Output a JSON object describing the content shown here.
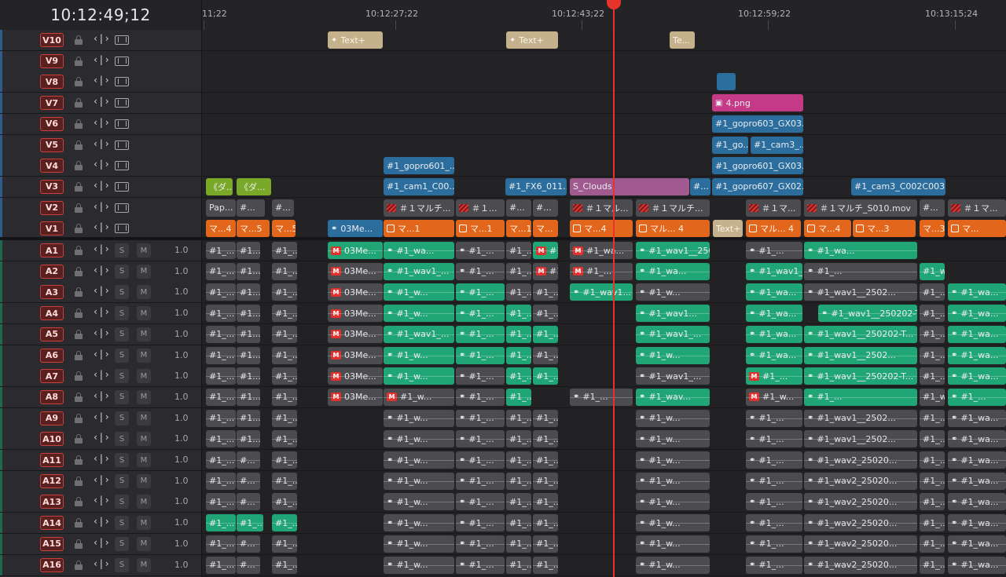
{
  "timecode": "10:12:49;12",
  "ruler": {
    "labels": [
      "11;22",
      "10:12:27;22",
      "10:12:43;22",
      "10:12:59;22",
      "10:13:15;24"
    ]
  },
  "video_tracks": [
    "V10",
    "V9",
    "V8",
    "V7",
    "V6",
    "V5",
    "V4",
    "V3",
    "V2",
    "V1"
  ],
  "audio_tracks": [
    {
      "name": "A1",
      "vol": "1.0",
      "s": "S",
      "m": "M"
    },
    {
      "name": "A2",
      "vol": "1.0",
      "s": "S",
      "m": "M"
    },
    {
      "name": "A3",
      "vol": "1.0",
      "s": "S",
      "m": "M"
    },
    {
      "name": "A4",
      "vol": "1.0",
      "s": "S",
      "m": "M"
    },
    {
      "name": "A5",
      "vol": "1.0",
      "s": "S",
      "m": "M"
    },
    {
      "name": "A6",
      "vol": "1.0",
      "s": "S",
      "m": "M"
    },
    {
      "name": "A7",
      "vol": "1.0",
      "s": "S",
      "m": "M"
    },
    {
      "name": "A8",
      "vol": "1.0",
      "s": "S",
      "m": "M"
    },
    {
      "name": "A9",
      "vol": "1.0",
      "s": "S",
      "m": "M"
    },
    {
      "name": "A10",
      "vol": "1.0",
      "s": "S",
      "m": "M"
    },
    {
      "name": "A11",
      "vol": "1.0",
      "s": "S",
      "m": "M"
    },
    {
      "name": "A12",
      "vol": "1.0",
      "s": "S",
      "m": "M"
    },
    {
      "name": "A13",
      "vol": "1.0",
      "s": "S",
      "m": "M"
    },
    {
      "name": "A14",
      "vol": "1.0",
      "s": "S",
      "m": "M"
    },
    {
      "name": "A15",
      "vol": "1.0",
      "s": "S",
      "m": "M"
    },
    {
      "name": "A16",
      "vol": "1.0",
      "s": "S",
      "m": "M"
    }
  ],
  "autoselect_glyph": "‹|›",
  "clips": {
    "v10": [
      {
        "label": "Text+",
        "color": "tan",
        "icon": "spark"
      },
      {
        "label": "Text+",
        "color": "tan",
        "icon": "spark"
      },
      {
        "label": "Te...",
        "color": "tan"
      }
    ],
    "v8": [
      {
        "label": "",
        "color": "blue"
      }
    ],
    "v7": [
      {
        "label": "4.png",
        "color": "pink",
        "icon": "image"
      }
    ],
    "v6": [
      {
        "label": "#1_gopro603_GX03...",
        "color": "blue"
      }
    ],
    "v5": [
      {
        "label": "#1_go...",
        "color": "blue"
      },
      {
        "label": "#1_cam3_...",
        "color": "blue"
      }
    ],
    "v4": [
      {
        "label": "#1_gopro601_...",
        "color": "blue"
      },
      {
        "label": "#1_gopro601_GX03...",
        "color": "blue"
      }
    ],
    "v3": [
      {
        "label": "《ダ...",
        "color": "lime"
      },
      {
        "label": "《ダ...",
        "color": "lime"
      },
      {
        "label": "#1_cam1_C00...",
        "color": "blue"
      },
      {
        "label": "#1_FX6_011...",
        "color": "blue"
      },
      {
        "label": "S_Clouds",
        "color": "violet"
      },
      {
        "label": "#...",
        "color": "blue"
      },
      {
        "label": "#1_gopro607_GX02...",
        "color": "blue"
      },
      {
        "label": "#1_cam3_C002C003...",
        "color": "blue"
      }
    ],
    "v2": [
      {
        "label": "Pap...",
        "color": "gray"
      },
      {
        "label": "#...",
        "color": "gray"
      },
      {
        "label": "#...",
        "color": "gray"
      },
      {
        "label": "＃１マルチ...",
        "color": "gray",
        "icon": "red"
      },
      {
        "label": "＃１...",
        "color": "gray",
        "icon": "red"
      },
      {
        "label": "#...",
        "color": "gray"
      },
      {
        "label": "#...",
        "color": "gray"
      },
      {
        "label": "＃１マル...",
        "color": "gray",
        "icon": "red"
      },
      {
        "label": "＃１マルチ...",
        "color": "gray",
        "icon": "red"
      },
      {
        "label": "＃１マ...",
        "color": "gray",
        "icon": "red"
      },
      {
        "label": "＃１マルチ_S010.mov",
        "color": "gray",
        "icon": "red"
      },
      {
        "label": "#...",
        "color": "gray"
      },
      {
        "label": "＃１マ...",
        "color": "gray",
        "icon": "red"
      }
    ],
    "v1": [
      {
        "label": "マ...4",
        "color": "orange"
      },
      {
        "label": "マ...5",
        "color": "orange"
      },
      {
        "label": "マ...5",
        "color": "orange"
      },
      {
        "label": "03Me...",
        "color": "blue",
        "icon": "link"
      },
      {
        "label": "マ...1",
        "color": "orange",
        "icon": "grid"
      },
      {
        "label": "マ...1",
        "color": "orange",
        "icon": "grid"
      },
      {
        "label": "マ...1",
        "color": "orange"
      },
      {
        "label": "マ...",
        "color": "orange"
      },
      {
        "label": "マ...4",
        "color": "orange",
        "icon": "grid"
      },
      {
        "label": "マル... 4",
        "color": "orange",
        "icon": "grid"
      },
      {
        "label": "Text+",
        "color": "tan"
      },
      {
        "label": "マル... 4",
        "color": "orange",
        "icon": "grid"
      },
      {
        "label": "マ...4",
        "color": "orange",
        "icon": "grid"
      },
      {
        "label": "マ...3",
        "color": "orange",
        "icon": "grid"
      },
      {
        "label": "マ...3",
        "color": "orange"
      },
      {
        "label": "マ...",
        "color": "orange",
        "icon": "grid"
      }
    ],
    "a1": [
      "#1_...",
      "#1...",
      "#1_...",
      "03Me...",
      "#1_wa...",
      "#1_...",
      "#1_...",
      "#1_...",
      "#1_wa...",
      "#1_wav1__2502...",
      "#1_...",
      "#1_wa..."
    ],
    "a2": [
      "#1_...",
      "#1...",
      "#1_...",
      "03Me...",
      "#1_wav1_...",
      "#1_...",
      "#1_...",
      "#1_...",
      "#1_...",
      "#1_wa...",
      "#1_wav1__250202-T...",
      "#1_...",
      "#1_wa..."
    ],
    "a3": [
      "#1_...",
      "#1...",
      "#1_...",
      "03Me...",
      "#1_w...",
      "#1_...",
      "#1_...",
      "#1_...",
      "#1_wav1...",
      "#1_w...",
      "#1_wa...",
      "#1_wav1__2502...",
      "#1_...",
      "#1_wa..."
    ],
    "a4": [
      "#1_...",
      "#1...",
      "#1_...",
      "03Me...",
      "#1_w...",
      "#1_...",
      "#1_...",
      "#1_...",
      "#1_wav1...",
      "#1_wa...",
      "#1_wav1__250202-T0...",
      "#1_...",
      "#1_wa..."
    ],
    "a5": [
      "#1_...",
      "#1...",
      "#1_...",
      "03Me...",
      "#1_wav1_...",
      "#1_...",
      "#1_...",
      "#1_...",
      "#1_wav1_...",
      "#1_wa...",
      "#1_wav1__250202-T...",
      "#1_...",
      "#1_wa..."
    ],
    "a6": [
      "#1_...",
      "#1...",
      "#1_...",
      "03Me...",
      "#1_w...",
      "#1_...",
      "#1_...",
      "#1_...",
      "#1_w...",
      "#1_wa...",
      "#1_wav1__2502...",
      "#1_...",
      "#1_wa..."
    ],
    "a7": [
      "#1_...",
      "#1...",
      "#1_...",
      "03Me...",
      "#1_w...",
      "#1_...",
      "#1_...",
      "#1_...",
      "#1_wav1_...",
      "#1_...",
      "#1_wav1__250202-T...",
      "#1_...",
      "#1_wa..."
    ],
    "a8": [
      "#1_...",
      "#1...",
      "#1_...",
      "03Me...",
      "#1_w...",
      "#1_...",
      "#1_...",
      "#1_...",
      "#1_wav...",
      "#1_w...",
      "#1_...",
      "#1_wav1__250202-T...",
      "#1_...",
      "#1_wa..."
    ],
    "a9": [
      "#1_...",
      "#1...",
      "#1_...",
      "#1_w...",
      "#1_...",
      "#1_...",
      "#1_...",
      "#1_w...",
      "#1_...",
      "#1_wav1__2502...",
      "#1_...",
      "#1_wa..."
    ],
    "a10": [
      "#1_...",
      "#1...",
      "#1_...",
      "#1_w...",
      "#1_...",
      "#1_...",
      "#1_...",
      "#1_w...",
      "#1_...",
      "#1_wav1__2502...",
      "#1_...",
      "#1_wa..."
    ],
    "a11": [
      "#1_...",
      "#...",
      "#1_...",
      "#1_w...",
      "#1_...",
      "#1_...",
      "#1_...",
      "#1_w...",
      "#1_...",
      "#1_wav2_25020...",
      "#1_...",
      "#1_wa..."
    ],
    "a12": [
      "#1_...",
      "#...",
      "#1_...",
      "#1_w...",
      "#1_...",
      "#1_...",
      "#1_...",
      "#1_w...",
      "#1_...",
      "#1_wav2_25020...",
      "#1_...",
      "#1_wa..."
    ],
    "a13": [
      "#1_...",
      "#...",
      "#1_...",
      "#1_w...",
      "#1_...",
      "#1_...",
      "#1_...",
      "#1_w...",
      "#1_...",
      "#1_wav2_25020...",
      "#1_...",
      "#1_wa..."
    ],
    "a14": [
      "#1_...",
      "#1_...",
      "#1_...",
      "#1_w...",
      "#1_...",
      "#1_...",
      "#1_...",
      "#1_w...",
      "#1_...",
      "#1_wav2_25020...",
      "#1_...",
      "#1_wa..."
    ],
    "a15": [
      "#1_...",
      "#...",
      "#1_...",
      "#1_w...",
      "#1_...",
      "#1_...",
      "#1_...",
      "#1_w...",
      "#1_...",
      "#1_wav2_25020...",
      "#1_...",
      "#1_wa..."
    ],
    "a16": [
      "#1_...",
      "#...",
      "#1_...",
      "#1_w...",
      "#1_...",
      "#1_...",
      "#1_...",
      "#1_w...",
      "#1_...",
      "#1_wav2_25020...",
      "#1_...",
      "#1_wa..."
    ]
  },
  "colors": {
    "playhead": "#e8322c",
    "track_badge": "#c9403c",
    "orange": "#e2661b",
    "green": "#1fa576",
    "blue": "#2b6e9e",
    "tan": "#c5b18b",
    "gray": "#4b4b50",
    "pink": "#c53a86",
    "lime": "#7aa829",
    "violet": "#a05a90"
  }
}
